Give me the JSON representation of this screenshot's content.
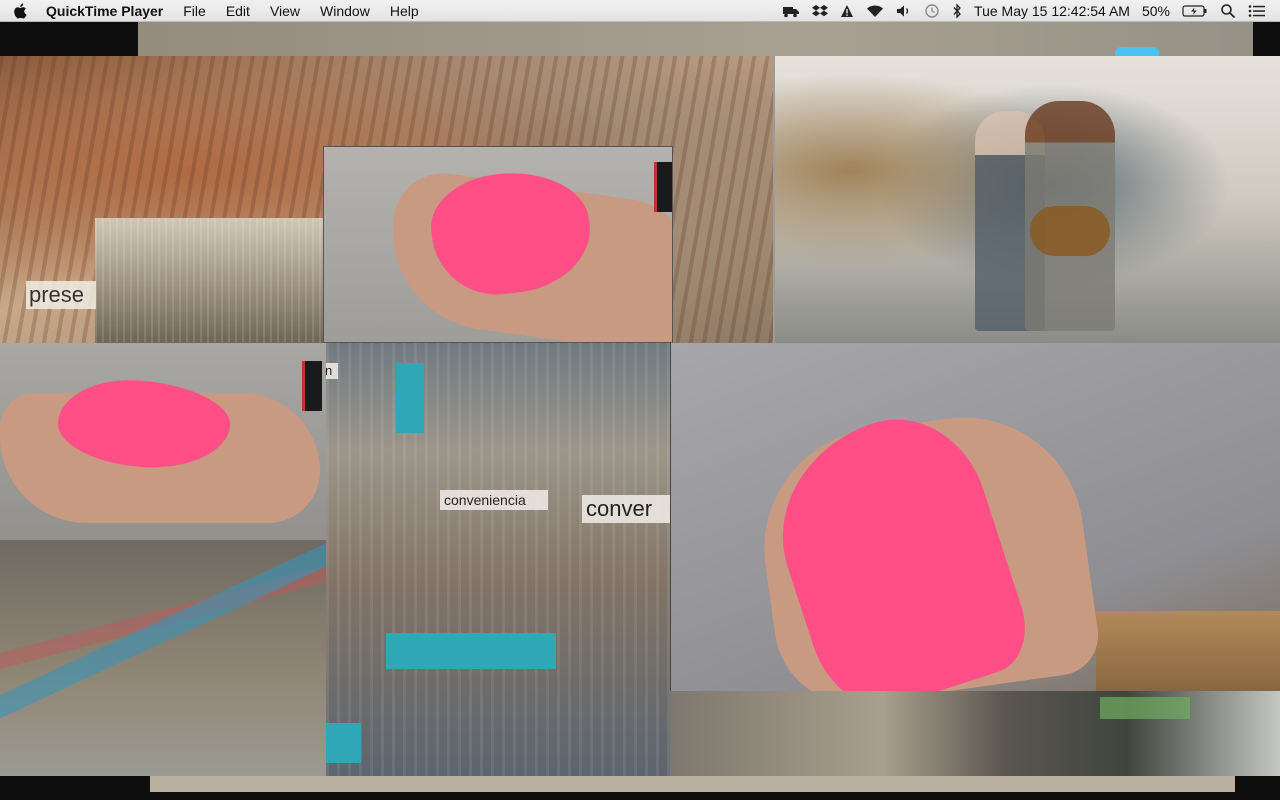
{
  "menubar": {
    "app_name": "QuickTime Player",
    "menus": [
      "File",
      "Edit",
      "View",
      "Window",
      "Help"
    ],
    "status": {
      "clock": "Tue May 15  12:42:54 AM",
      "battery": "50%"
    },
    "tray_icons": [
      "truck-icon",
      "dropbox-icon",
      "warning-icon",
      "wifi-icon",
      "volume-icon",
      "time-machine-icon",
      "bluetooth-icon",
      "battery-icon",
      "spotlight-icon",
      "notification-center-icon"
    ]
  },
  "video": {
    "overlay_texts": {
      "cave": "prese",
      "middle_letter": "n",
      "center_caption": "conveniencia",
      "right_caption": "conver"
    }
  },
  "colors": {
    "menubar_bg": "#ececec",
    "clay_pink": "#ff4f86",
    "teal": "#2fa7b6"
  }
}
